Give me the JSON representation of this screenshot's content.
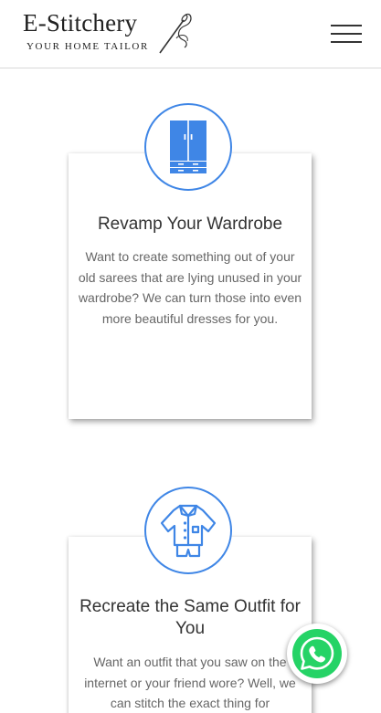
{
  "brand": {
    "title": "E-Stitchery",
    "tagline": "YOUR HOME TAILOR",
    "accent_color": "#3f86e6",
    "whatsapp_color": "#25d366"
  },
  "header": {
    "menu_icon": "hamburger-menu-icon"
  },
  "services": [
    {
      "icon": "wardrobe-icon",
      "title": "Revamp Your Wardrobe",
      "description": "Want to create something out of your old sarees that are lying unused in your wardrobe? We can turn those into even more beautiful dresses for you."
    },
    {
      "icon": "outfit-icon",
      "title": "Recreate the Same Outfit for You",
      "description": "Want an outfit that you saw on the internet or your friend wore? Well, we can stitch the exact thing for"
    }
  ],
  "floating": {
    "icon": "whatsapp-icon"
  }
}
